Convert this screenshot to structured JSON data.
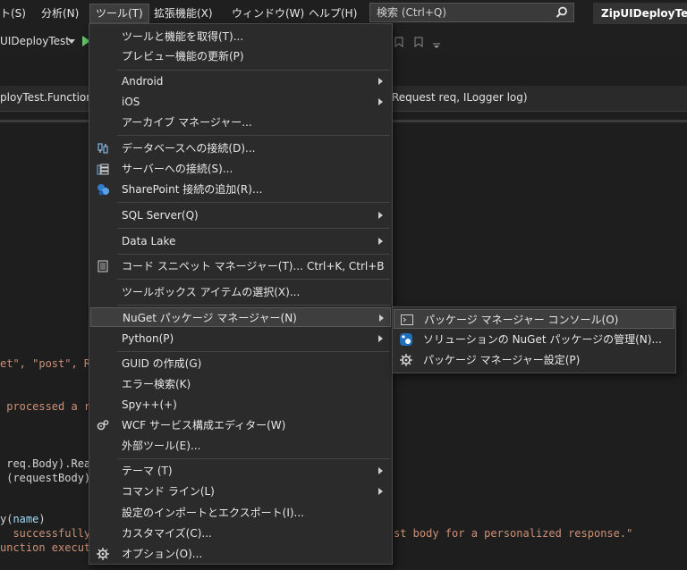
{
  "menubar": {
    "items": [
      "ト(S)",
      "分析(N)",
      "ツール(T)",
      "拡張機能(X)",
      "ウィンドウ(W)",
      "ヘルプ(H)"
    ],
    "search_placeholder": "検索 (Ctrl+Q)",
    "title": "ZipUIDeployTest"
  },
  "toolbar": {
    "project": "UIDeployTest"
  },
  "navbar": {
    "left": "ployTest.Function1",
    "right": "Request req, ILogger log)"
  },
  "code": {
    "l1a": "et\", \"post\", R",
    "l2a": " processed a r",
    "l3a": " req.Body).Read",
    "l4a": " (requestBody);",
    "l5a": "y(",
    "l5b": "name",
    "l5c": ")",
    "l6a": "  successfully.",
    "l6b": "st body for a personalized response.\"",
    "l7a": "unction execut"
  },
  "tools_menu": {
    "items": [
      {
        "label": "ツールと機能を取得(T)..."
      },
      {
        "label": "プレビュー機能の更新(P)"
      },
      {
        "label": "Android"
      },
      {
        "label": "iOS"
      },
      {
        "label": "アーカイブ マネージャー..."
      },
      {
        "label": "データベースへの接続(D)..."
      },
      {
        "label": "サーバーへの接続(S)..."
      },
      {
        "label": "SharePoint 接続の追加(R)..."
      },
      {
        "label": "SQL Server(Q)"
      },
      {
        "label": "Data Lake"
      },
      {
        "label": "コード スニペット マネージャー(T)...",
        "shortcut": "Ctrl+K, Ctrl+B"
      },
      {
        "label": "ツールボックス アイテムの選択(X)..."
      },
      {
        "label": "NuGet パッケージ マネージャー(N)"
      },
      {
        "label": "Python(P)"
      },
      {
        "label": "GUID の作成(G)"
      },
      {
        "label": "エラー検索(K)"
      },
      {
        "label": "Spy++(+)"
      },
      {
        "label": "WCF サービス構成エディター(W)"
      },
      {
        "label": "外部ツール(E)..."
      },
      {
        "label": "テーマ (T)"
      },
      {
        "label": "コマンド ライン(L)"
      },
      {
        "label": "設定のインポートとエクスポート(I)..."
      },
      {
        "label": "カスタマイズ(C)..."
      },
      {
        "label": "オプション(O)..."
      }
    ]
  },
  "nuget_menu": {
    "items": [
      {
        "label": "パッケージ マネージャー コンソール(O)"
      },
      {
        "label": "ソリューションの NuGet パッケージの管理(N)..."
      },
      {
        "label": "パッケージ マネージャー設定(P)"
      }
    ]
  },
  "colors": {
    "background": "#1e1e1e",
    "menu": "#2b2b2b",
    "highlight": "#3e3e3e",
    "string": "#ce9178",
    "identifier": "#9cdcfe"
  }
}
